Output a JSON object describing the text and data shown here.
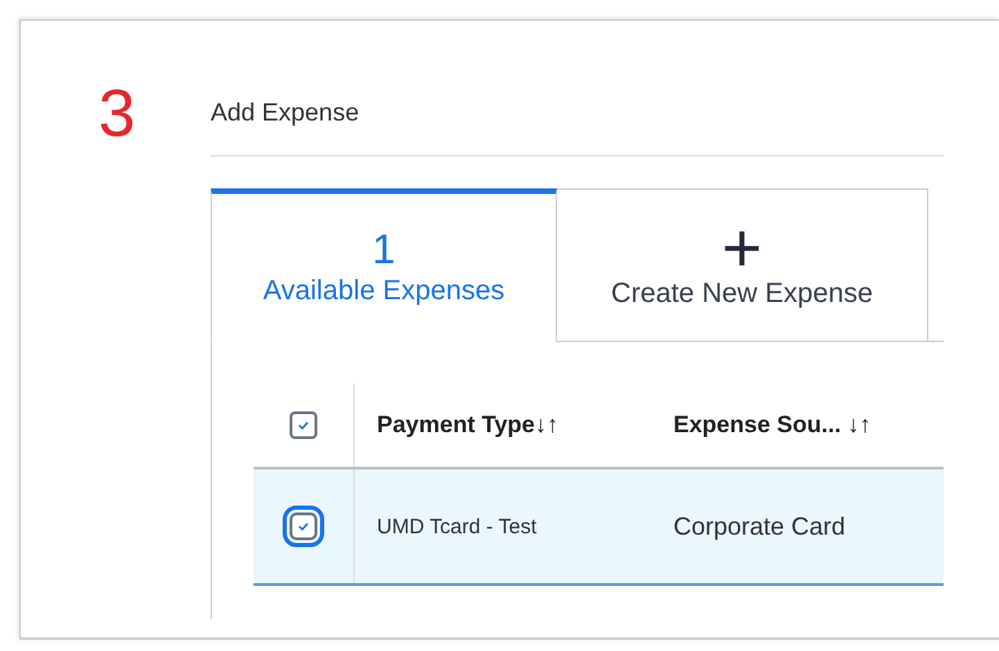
{
  "step_number": "3",
  "title": "Add Expense",
  "tabs": [
    {
      "kind": "count",
      "count": "1",
      "label": "Available Expenses",
      "selected": true
    },
    {
      "kind": "create",
      "icon_text": "+",
      "label": "Create New Expense",
      "selected": false
    }
  ],
  "table": {
    "select_all_checked": true,
    "columns": [
      "Payment Type↓↑",
      "Expense Sou... ↓↑"
    ],
    "rows": [
      {
        "checked": true,
        "selected": true,
        "cells": [
          "UMD Tcard - Test",
          "Corporate Card"
        ]
      }
    ]
  }
}
